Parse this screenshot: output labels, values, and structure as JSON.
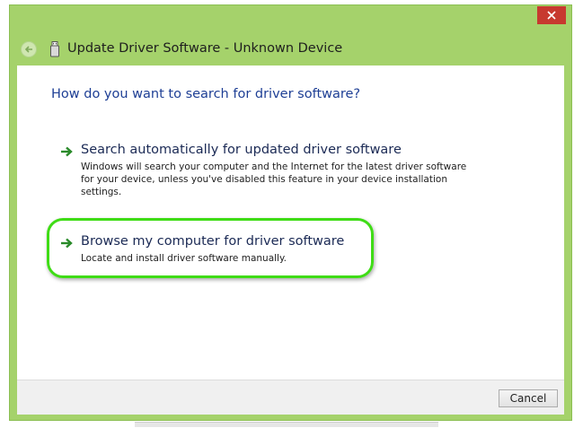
{
  "window": {
    "title": "Update Driver Software - Unknown Device",
    "frame_color": "#a5d26b",
    "close_color": "#c7392f"
  },
  "icons": {
    "back": "back-arrow-icon",
    "device": "usb-device-icon",
    "option_arrow": "green-arrow-icon",
    "close": "close-icon"
  },
  "main": {
    "heading": "How do you want to search for driver software?",
    "options": [
      {
        "title": "Search automatically for updated driver software",
        "description_lines": [
          "Windows will search your computer and the Internet for the latest driver software",
          "for your device, unless you've disabled this feature in your device installation",
          "settings."
        ]
      },
      {
        "title": "Browse my computer for driver software",
        "description_lines": [
          "Locate and install driver software manually."
        ],
        "highlighted": true,
        "highlight_color": "#3fdc16"
      }
    ]
  },
  "footer": {
    "cancel_label": "Cancel"
  }
}
